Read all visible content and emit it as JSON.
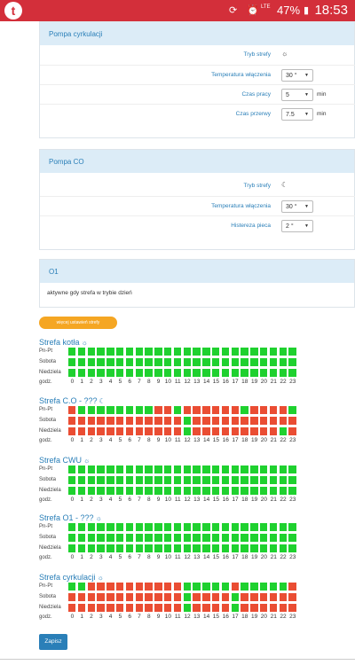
{
  "status": {
    "time": "18:53",
    "battery": "47%",
    "lte": "LTE",
    "logo": "t"
  },
  "pump_circ": {
    "title": "Pompa cyrkulacji",
    "rows": [
      {
        "label": "Tryb strefy",
        "icon": "sun-icon",
        "glyph": "☼"
      },
      {
        "label": "Temperatura włączenia",
        "value": "30 °"
      },
      {
        "label": "Czas pracy",
        "value": "5",
        "unit": "min"
      },
      {
        "label": "Czas przerwy",
        "value": "7.5",
        "unit": "min"
      }
    ]
  },
  "pump_co": {
    "title": "Pompa CO",
    "rows": [
      {
        "label": "Tryb strefy",
        "icon": "moon-icon",
        "glyph": "☾"
      },
      {
        "label": "Temperatura włączenia",
        "value": "30 °"
      },
      {
        "label": "Histereza pieca",
        "value": "2 °"
      }
    ]
  },
  "o1": {
    "title": "O1",
    "text": "aktywne gdy strefa w trybie dzień"
  },
  "yellow_button": "więcej ustawień strefy",
  "hours": [
    "0",
    "1",
    "2",
    "3",
    "4",
    "5",
    "6",
    "7",
    "8",
    "9",
    "10",
    "11",
    "12",
    "13",
    "14",
    "15",
    "16",
    "17",
    "18",
    "19",
    "20",
    "21",
    "22",
    "23"
  ],
  "hours_label": "godz.",
  "zones": [
    {
      "title": "Strefa kotła",
      "icon": "sun-icon",
      "glyph": "☼",
      "days": [
        {
          "label": "Pn-Pt",
          "cells": "GGGGGGGGGGGGGGGGGGGGGGGG"
        },
        {
          "label": "Sobota",
          "cells": "GGGGGGGGGGGGGGGGGGGGGGGG"
        },
        {
          "label": "Niedziela",
          "cells": "GGGGGGGGGGGGGGGGGGGGGGGG"
        }
      ]
    },
    {
      "title": "Strefa C.O - ???",
      "icon": "moon-icon",
      "glyph": "☾",
      "days": [
        {
          "label": "Pn-Pt",
          "cells": "RGGGGGGGGRRGRRRRRRGRRRRGRR"
        },
        {
          "label": "Sobota",
          "cells": "RRRRRRRRRRRRGRRRRRRRRRRR"
        },
        {
          "label": "Niedziela",
          "cells": "RRRRRRRRRRRRGRRRRRRRRRGR"
        }
      ]
    },
    {
      "title": "Strefa CWU",
      "icon": "sun-icon",
      "glyph": "☼",
      "days": [
        {
          "label": "Pn-Pt",
          "cells": "GGGGGGGGGGGGGGGGGGGGGGGG"
        },
        {
          "label": "Sobota",
          "cells": "GGGGGGGGGGGGGGGGGGGGGGGG"
        },
        {
          "label": "Niedziela",
          "cells": "GGGGGGGGGGGGGGGGGGGGGGGG"
        }
      ]
    },
    {
      "title": "Strefa O1 - ???",
      "icon": "sun-icon",
      "glyph": "☼",
      "days": [
        {
          "label": "Pn-Pt",
          "cells": "GGGGGGGGGGGGGGGGGGGGGGGG"
        },
        {
          "label": "Sobota",
          "cells": "GGGGGGGGGGGGGGGGGGGGGGGG"
        },
        {
          "label": "Niedziela",
          "cells": "GGGGGGGGGGGGGGGGGGGGGGGG"
        }
      ]
    },
    {
      "title": "Strefa cyrkulacji",
      "icon": "sun-icon",
      "glyph": "☼",
      "days": [
        {
          "label": "Pn-Pt",
          "cells": "GGRRRRRRRRRRGGGGGRGGGGGR"
        },
        {
          "label": "Sobota",
          "cells": "RRRRRRRRRRRRGRRRRGRRRRRR"
        },
        {
          "label": "Niedziela",
          "cells": "RRRRRRRRRRRRGRRRRGRRRRRR"
        }
      ]
    }
  ],
  "save_button": "Zapisz",
  "colors": {
    "green": "#1fd12f",
    "red": "#ea4d33",
    "accent": "#2a7fb8",
    "statusbar": "#d32f3a"
  }
}
